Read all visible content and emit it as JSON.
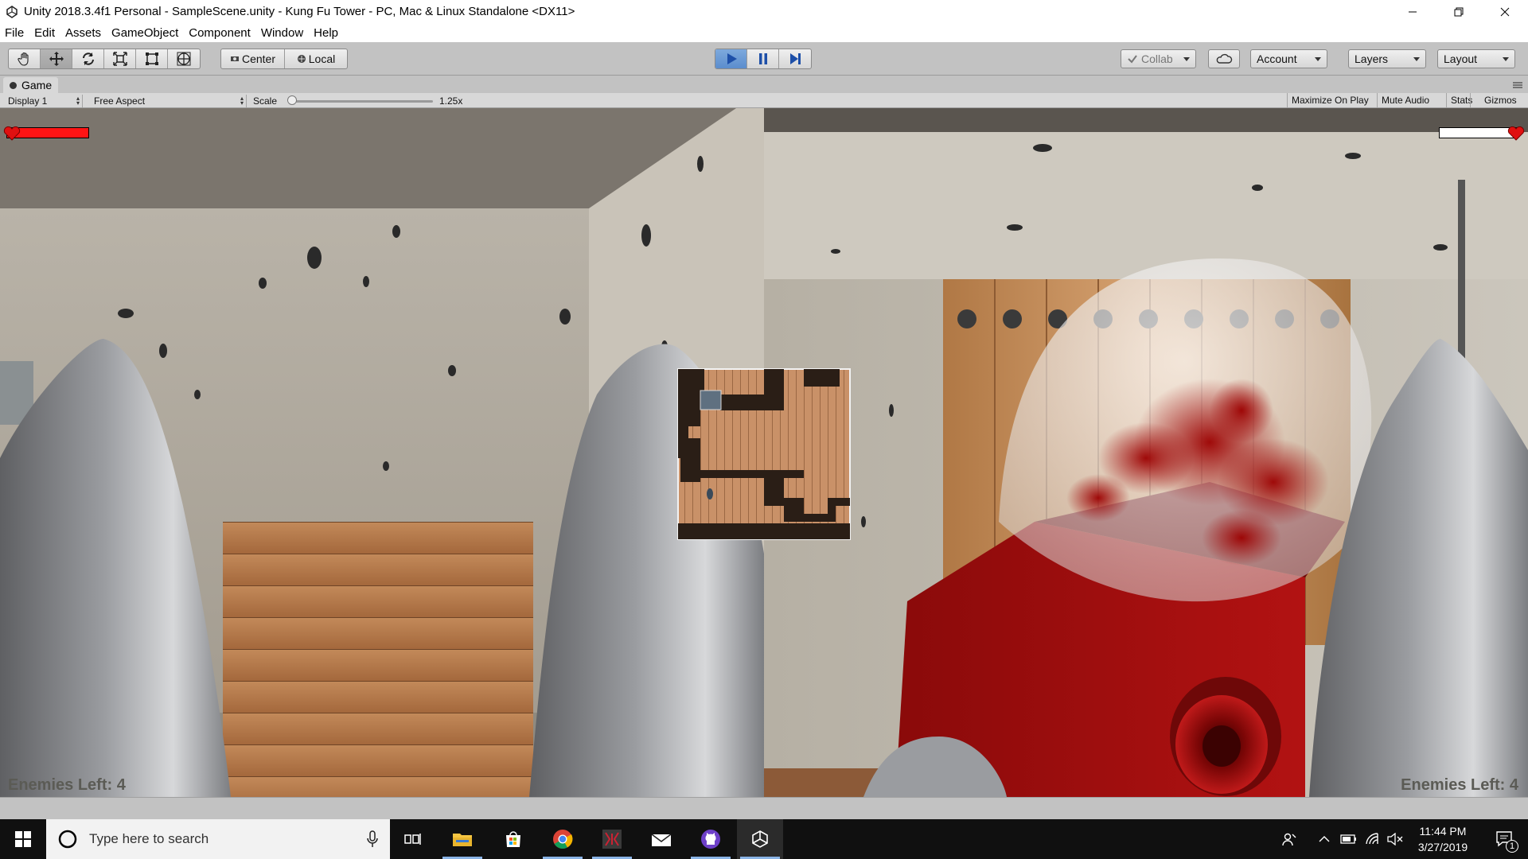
{
  "window": {
    "title": "Unity 2018.3.4f1 Personal - SampleScene.unity - Kung Fu Tower - PC, Mac & Linux Standalone <DX11>",
    "controls": [
      "minimize-icon",
      "restore-icon",
      "close-icon"
    ]
  },
  "menu": [
    "File",
    "Edit",
    "Assets",
    "GameObject",
    "Component",
    "Window",
    "Help"
  ],
  "toolbar": {
    "tools": [
      "hand-tool-icon",
      "move-tool-icon",
      "rotate-tool-icon",
      "scale-tool-icon",
      "rect-tool-icon",
      "transform-tool-icon"
    ],
    "pivot_label": "Center",
    "space_label": "Local",
    "play_state": "playing",
    "collab_label": "Collab",
    "account_label": "Account",
    "layers_label": "Layers",
    "layout_label": "Layout"
  },
  "game_view": {
    "tab_label": "Game",
    "display": "Display 1",
    "aspect": "Free Aspect",
    "scale_label": "Scale",
    "scale_value": "1.25x",
    "scale_fraction": 0.03,
    "buttons": [
      "Maximize On Play",
      "Mute Audio",
      "Stats",
      "Gizmos"
    ]
  },
  "hud": {
    "left_enemies": "Enemies Left: 4",
    "right_enemies": "Enemies Left: 4",
    "player_health": 1.0,
    "enemy_health": 0.0
  },
  "taskbar": {
    "search_placeholder": "Type here to search",
    "apps": [
      "task-view-icon",
      "file-explorer-icon",
      "store-icon",
      "chrome-icon",
      "app-icon",
      "mail-icon",
      "github-icon",
      "unity-icon"
    ],
    "time": "11:44 PM",
    "date": "3/27/2019",
    "notification_count": "1"
  }
}
